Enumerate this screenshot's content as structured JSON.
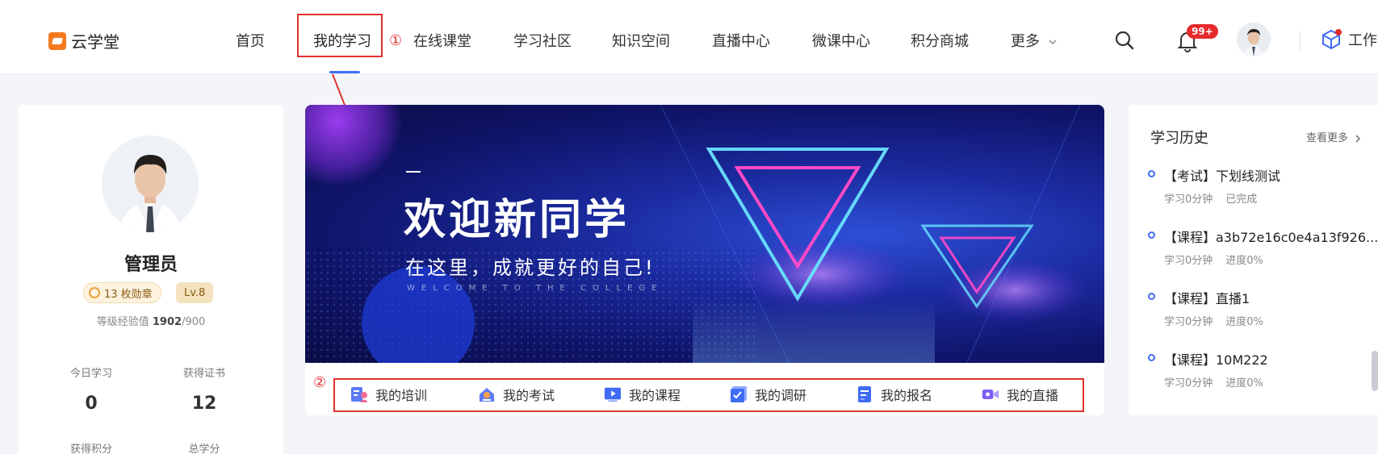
{
  "header": {
    "logo_text": "云学堂",
    "nav": [
      {
        "label": "首页"
      },
      {
        "label": "我的学习",
        "active": true
      },
      {
        "label": "在线课堂"
      },
      {
        "label": "学习社区"
      },
      {
        "label": "知识空间"
      },
      {
        "label": "直播中心"
      },
      {
        "label": "微课中心"
      },
      {
        "label": "积分商城"
      },
      {
        "label": "更多"
      }
    ],
    "notification_badge": "99+",
    "workbench_label": "工作"
  },
  "annotations": {
    "marker_1": "①",
    "marker_2": "②",
    "color": "#e0322e"
  },
  "profile": {
    "name": "管理员",
    "medal_text": "13 枚勋章",
    "level": "Lv.8",
    "exp_label": "等级经验值",
    "exp_current": "1902",
    "exp_total": "/900",
    "stats": [
      {
        "label": "今日学习",
        "value": "0"
      },
      {
        "label": "获得证书",
        "value": "12"
      },
      {
        "label": "获得积分",
        "value": ""
      },
      {
        "label": "总学分",
        "value": ""
      }
    ]
  },
  "banner": {
    "title": "欢迎新同学",
    "subtitle": "在这里，成就更好的自己!",
    "english": "WELCOME TO THE COLLEGE"
  },
  "shortcuts": [
    {
      "label": "我的培训",
      "icon": "training-icon"
    },
    {
      "label": "我的考试",
      "icon": "exam-icon"
    },
    {
      "label": "我的课程",
      "icon": "course-icon"
    },
    {
      "label": "我的调研",
      "icon": "survey-icon"
    },
    {
      "label": "我的报名",
      "icon": "signup-icon"
    },
    {
      "label": "我的直播",
      "icon": "live-icon"
    }
  ],
  "history": {
    "title": "学习历史",
    "more": "查看更多",
    "items": [
      {
        "name": "【考试】下划线测试",
        "time": "学习0分钟",
        "status": "已完成"
      },
      {
        "name": "【课程】a3b72e16c0e4a13f926...",
        "time": "学习0分钟",
        "status": "进度0%"
      },
      {
        "name": "【课程】直播1",
        "time": "学习0分钟",
        "status": "进度0%"
      },
      {
        "name": "【课程】10M222",
        "time": "学习0分钟",
        "status": "进度0%"
      }
    ]
  },
  "colors": {
    "accent": "#3f6cf5",
    "brand": "#f47a1f",
    "badge": "#e72b2b"
  }
}
